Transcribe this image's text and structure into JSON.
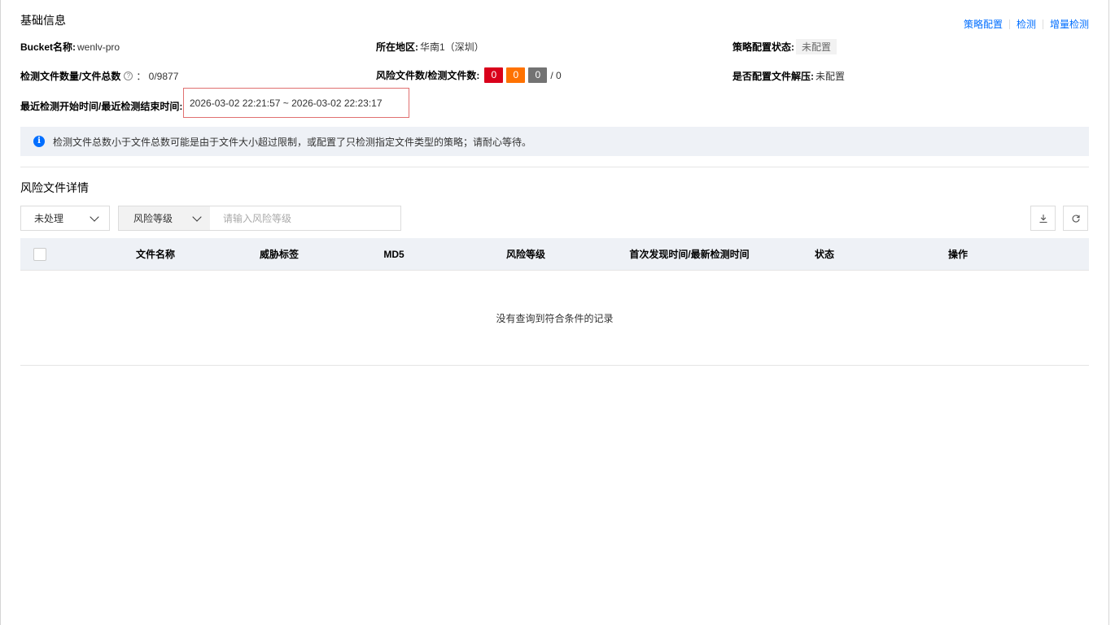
{
  "basic": {
    "title": "基础信息",
    "actions": {
      "policy_config": "策略配置",
      "detect": "检测",
      "incremental_detect": "增量检测"
    },
    "bucket_label": "Bucket名称:",
    "bucket_value": "wenlv-pro",
    "region_label": "所在地区:",
    "region_value": "华南1（深圳）",
    "policy_status_label": "策略配置状态:",
    "policy_status_value": "未配置",
    "file_count_label": "检测文件数量/文件总数",
    "file_count_help": "?",
    "file_count_value": "：  0/9877",
    "risk_files_label": "风险文件数/检测文件数:",
    "risk_counts": {
      "high": "0",
      "mid": "0",
      "low": "0"
    },
    "risk_total": "/ 0",
    "decompress_label": "是否配置文件解压:",
    "decompress_value": "未配置",
    "time_label": "最近检测开始时间/最近检测结束时间:",
    "time_value": "2026-03-02 22:21:57 ~ 2026-03-02 22:23:17"
  },
  "notice": {
    "icon": "i",
    "text": "检测文件总数小于文件总数可能是由于文件大小超过限制，或配置了只检测指定文件类型的策略；请耐心等待。"
  },
  "risk_section": {
    "title": "风险文件详情",
    "status_filter": "未处理",
    "risk_level_select": "风险等级",
    "risk_level_placeholder": "请输入风险等级",
    "columns": [
      "文件名称",
      "威胁标签",
      "MD5",
      "风险等级",
      "首次发现时间/最新检测时间",
      "状态",
      "操作"
    ],
    "empty_text": "没有查询到符合条件的记录"
  },
  "colors": {
    "accent": "#006eff",
    "risk_high": "#d9001b",
    "risk_mid": "#ff7200",
    "risk_low": "#737373",
    "highlight_border": "#e07070"
  }
}
